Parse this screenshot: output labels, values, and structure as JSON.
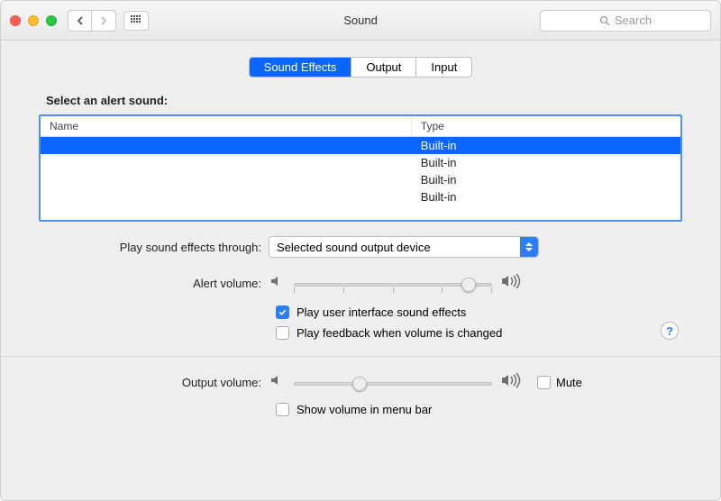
{
  "window": {
    "title": "Sound"
  },
  "search": {
    "placeholder": "Search"
  },
  "tabs": [
    {
      "label": "Sound Effects",
      "active": true
    },
    {
      "label": "Output",
      "active": false
    },
    {
      "label": "Input",
      "active": false
    }
  ],
  "alert_section": {
    "heading": "Select an alert sound:",
    "columns": {
      "name": "Name",
      "type": "Type"
    },
    "rows": [
      {
        "name": "",
        "type": "Built-in",
        "selected": true
      },
      {
        "name": "",
        "type": "Built-in",
        "selected": false
      },
      {
        "name": "",
        "type": "Built-in",
        "selected": false
      },
      {
        "name": "",
        "type": "Built-in",
        "selected": false
      }
    ]
  },
  "play_through": {
    "label": "Play sound effects through:",
    "selected": "Selected sound output device"
  },
  "alert_volume": {
    "label": "Alert volume:",
    "value": 0.88
  },
  "ui_sounds": {
    "label": "Play user interface sound effects",
    "checked": true
  },
  "feedback": {
    "label": "Play feedback when volume is changed",
    "checked": false
  },
  "output_volume": {
    "label": "Output volume:",
    "value": 0.33
  },
  "mute": {
    "label": "Mute",
    "checked": false
  },
  "menubar": {
    "label": "Show volume in menu bar",
    "checked": false
  }
}
